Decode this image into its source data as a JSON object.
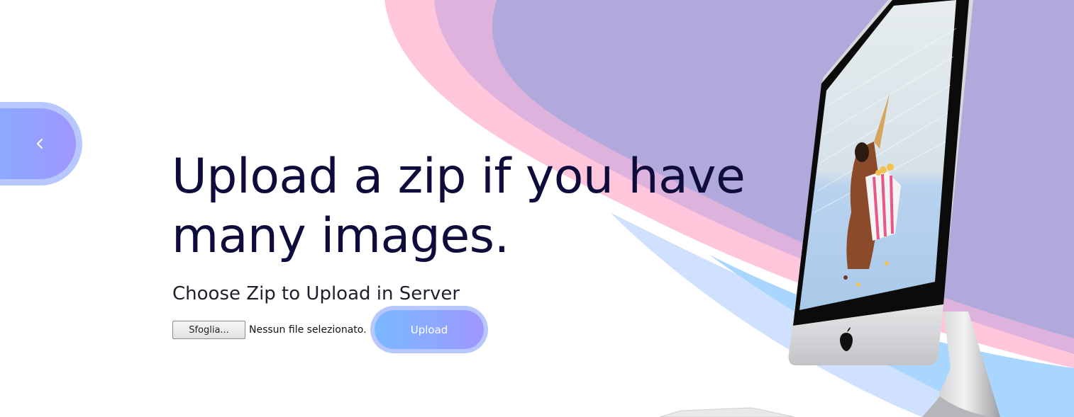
{
  "navigation": {
    "back_icon": "chevron-left-icon"
  },
  "hero": {
    "title_line1": "Upload a zip if you have",
    "title_line2": "many images."
  },
  "upload_form": {
    "heading": "Choose Zip to Upload in Server",
    "browse_label": "Sfoglia...",
    "file_status": "Nessun file selezionato.",
    "submit_label": "Upload"
  },
  "colors": {
    "title_text": "#0d0c3a",
    "button_gradient_start": "#7ab8ff",
    "button_gradient_end": "#a096ff",
    "button_halo": "#b8c8ff",
    "wave_pink": "#ffc6dc",
    "wave_mauve": "#ddb2dc",
    "wave_lavender": "#b1a9dc",
    "wave_blue": "#a8d6ff"
  },
  "illustration": {
    "device_icon": "imac-icon",
    "brand_icon": "apple-logo-icon"
  }
}
